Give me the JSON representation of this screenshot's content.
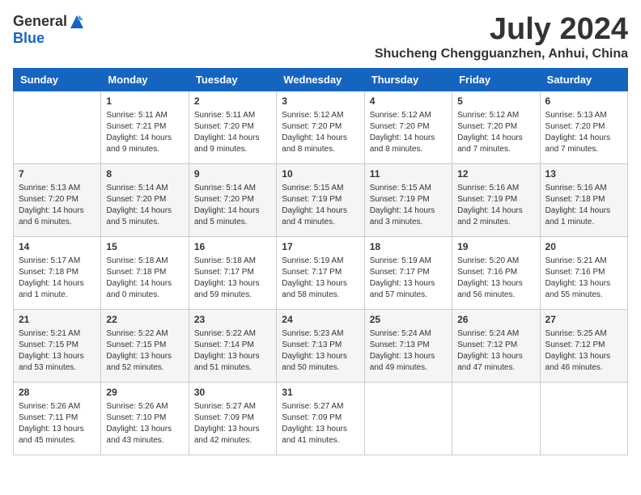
{
  "header": {
    "logo_general": "General",
    "logo_blue": "Blue",
    "month_year": "July 2024",
    "location": "Shucheng Chengguanzhen, Anhui, China"
  },
  "weekdays": [
    "Sunday",
    "Monday",
    "Tuesday",
    "Wednesday",
    "Thursday",
    "Friday",
    "Saturday"
  ],
  "weeks": [
    [
      {
        "day": "",
        "info": ""
      },
      {
        "day": "1",
        "info": "Sunrise: 5:11 AM\nSunset: 7:21 PM\nDaylight: 14 hours\nand 9 minutes."
      },
      {
        "day": "2",
        "info": "Sunrise: 5:11 AM\nSunset: 7:20 PM\nDaylight: 14 hours\nand 9 minutes."
      },
      {
        "day": "3",
        "info": "Sunrise: 5:12 AM\nSunset: 7:20 PM\nDaylight: 14 hours\nand 8 minutes."
      },
      {
        "day": "4",
        "info": "Sunrise: 5:12 AM\nSunset: 7:20 PM\nDaylight: 14 hours\nand 8 minutes."
      },
      {
        "day": "5",
        "info": "Sunrise: 5:12 AM\nSunset: 7:20 PM\nDaylight: 14 hours\nand 7 minutes."
      },
      {
        "day": "6",
        "info": "Sunrise: 5:13 AM\nSunset: 7:20 PM\nDaylight: 14 hours\nand 7 minutes."
      }
    ],
    [
      {
        "day": "7",
        "info": "Sunrise: 5:13 AM\nSunset: 7:20 PM\nDaylight: 14 hours\nand 6 minutes."
      },
      {
        "day": "8",
        "info": "Sunrise: 5:14 AM\nSunset: 7:20 PM\nDaylight: 14 hours\nand 5 minutes."
      },
      {
        "day": "9",
        "info": "Sunrise: 5:14 AM\nSunset: 7:20 PM\nDaylight: 14 hours\nand 5 minutes."
      },
      {
        "day": "10",
        "info": "Sunrise: 5:15 AM\nSunset: 7:19 PM\nDaylight: 14 hours\nand 4 minutes."
      },
      {
        "day": "11",
        "info": "Sunrise: 5:15 AM\nSunset: 7:19 PM\nDaylight: 14 hours\nand 3 minutes."
      },
      {
        "day": "12",
        "info": "Sunrise: 5:16 AM\nSunset: 7:19 PM\nDaylight: 14 hours\nand 2 minutes."
      },
      {
        "day": "13",
        "info": "Sunrise: 5:16 AM\nSunset: 7:18 PM\nDaylight: 14 hours\nand 1 minute."
      }
    ],
    [
      {
        "day": "14",
        "info": "Sunrise: 5:17 AM\nSunset: 7:18 PM\nDaylight: 14 hours\nand 1 minute."
      },
      {
        "day": "15",
        "info": "Sunrise: 5:18 AM\nSunset: 7:18 PM\nDaylight: 14 hours\nand 0 minutes."
      },
      {
        "day": "16",
        "info": "Sunrise: 5:18 AM\nSunset: 7:17 PM\nDaylight: 13 hours\nand 59 minutes."
      },
      {
        "day": "17",
        "info": "Sunrise: 5:19 AM\nSunset: 7:17 PM\nDaylight: 13 hours\nand 58 minutes."
      },
      {
        "day": "18",
        "info": "Sunrise: 5:19 AM\nSunset: 7:17 PM\nDaylight: 13 hours\nand 57 minutes."
      },
      {
        "day": "19",
        "info": "Sunrise: 5:20 AM\nSunset: 7:16 PM\nDaylight: 13 hours\nand 56 minutes."
      },
      {
        "day": "20",
        "info": "Sunrise: 5:21 AM\nSunset: 7:16 PM\nDaylight: 13 hours\nand 55 minutes."
      }
    ],
    [
      {
        "day": "21",
        "info": "Sunrise: 5:21 AM\nSunset: 7:15 PM\nDaylight: 13 hours\nand 53 minutes."
      },
      {
        "day": "22",
        "info": "Sunrise: 5:22 AM\nSunset: 7:15 PM\nDaylight: 13 hours\nand 52 minutes."
      },
      {
        "day": "23",
        "info": "Sunrise: 5:22 AM\nSunset: 7:14 PM\nDaylight: 13 hours\nand 51 minutes."
      },
      {
        "day": "24",
        "info": "Sunrise: 5:23 AM\nSunset: 7:13 PM\nDaylight: 13 hours\nand 50 minutes."
      },
      {
        "day": "25",
        "info": "Sunrise: 5:24 AM\nSunset: 7:13 PM\nDaylight: 13 hours\nand 49 minutes."
      },
      {
        "day": "26",
        "info": "Sunrise: 5:24 AM\nSunset: 7:12 PM\nDaylight: 13 hours\nand 47 minutes."
      },
      {
        "day": "27",
        "info": "Sunrise: 5:25 AM\nSunset: 7:12 PM\nDaylight: 13 hours\nand 46 minutes."
      }
    ],
    [
      {
        "day": "28",
        "info": "Sunrise: 5:26 AM\nSunset: 7:11 PM\nDaylight: 13 hours\nand 45 minutes."
      },
      {
        "day": "29",
        "info": "Sunrise: 5:26 AM\nSunset: 7:10 PM\nDaylight: 13 hours\nand 43 minutes."
      },
      {
        "day": "30",
        "info": "Sunrise: 5:27 AM\nSunset: 7:09 PM\nDaylight: 13 hours\nand 42 minutes."
      },
      {
        "day": "31",
        "info": "Sunrise: 5:27 AM\nSunset: 7:09 PM\nDaylight: 13 hours\nand 41 minutes."
      },
      {
        "day": "",
        "info": ""
      },
      {
        "day": "",
        "info": ""
      },
      {
        "day": "",
        "info": ""
      }
    ]
  ]
}
